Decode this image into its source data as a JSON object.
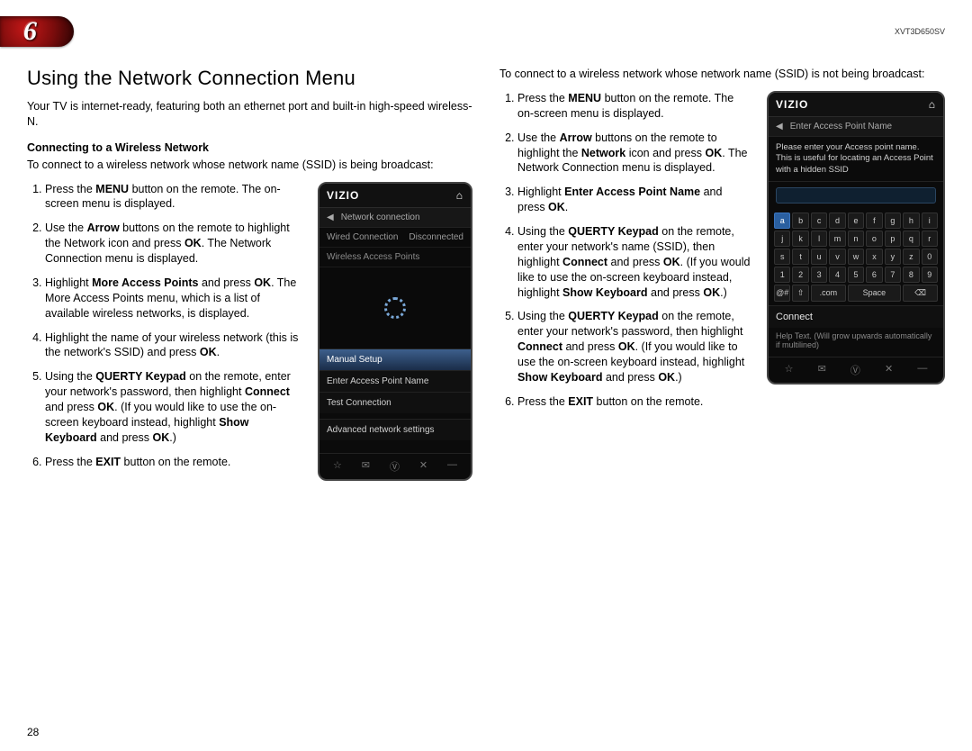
{
  "chapter_number": "6",
  "model": "XVT3D650SV",
  "page_number": "28",
  "left": {
    "title": "Using the Network Connection Menu",
    "intro": "Your TV is internet-ready, featuring both an ethernet port and built-in high-speed wireless-N.",
    "subhead": "Connecting to a Wireless Network",
    "lead": "To connect to a wireless network whose network name (SSID) is being broadcast:",
    "steps": [
      "Press the <b>MENU</b> button on the remote. The on-screen menu is displayed.",
      "Use the <b>Arrow</b> buttons on the remote to highlight the Network icon and press <b>OK</b>. The Network Connection menu is displayed.",
      "Highlight <b>More Access Points</b> and press <b>OK</b>. The More Access Points menu, which is a list of available wireless networks, is displayed.",
      "Highlight the name of your wireless network (this is the network's SSID) and press <b>OK</b>.",
      "Using the <b>QUERTY Keypad</b> on the remote, enter your network's password, then highlight <b>Connect</b> and press <b>OK</b>. (If you would like to use the on-screen keyboard instead, highlight <b>Show Keyboard</b> and press <b>OK</b>.)",
      "Press the <b>EXIT</b> button on the remote."
    ],
    "menu": {
      "brand": "VIZIO",
      "crumb": "Network connection",
      "wired_label": "Wired Connection",
      "wired_status": "Disconnected",
      "wap_label": "Wireless Access Points",
      "items": [
        "Manual Setup",
        "Enter Access Point Name",
        "Test Connection",
        "Advanced network settings"
      ]
    }
  },
  "right": {
    "lead": "To connect to a wireless network whose network name (SSID) is not being broadcast:",
    "steps": [
      "Press the <b>MENU</b> button on the remote. The on-screen menu is displayed.",
      "Use the <b>Arrow</b> buttons on the remote to highlight the <b>Network</b> icon and press <b>OK</b>. The Network Connection menu is displayed.",
      "Highlight <b>Enter Access Point Name</b> and press <b>OK</b>.",
      "Using the <b>QUERTY Keypad</b> on the remote, enter your network's name (SSID), then highlight <b>Connect</b> and press <b>OK</b>. (If you would like to use the on-screen keyboard instead, highlight <b>Show Keyboard</b> and press <b>OK</b>.)",
      "Using the <b>QUERTY Keypad</b> on the remote, enter your network's password, then highlight <b>Connect</b> and press <b>OK</b>. (If you would like to use the on-screen keyboard instead, highlight <b>Show Keyboard</b> and press <b>OK</b>.)",
      "Press the <b>EXIT</b> button on the remote."
    ],
    "keyboard": {
      "brand": "VIZIO",
      "crumb": "Enter Access Point Name",
      "note": "Please enter your Access point name. This is useful for locating an Access Point with a hidden SSID",
      "rows": [
        [
          "a",
          "b",
          "c",
          "d",
          "e",
          "f",
          "g",
          "h",
          "i"
        ],
        [
          "j",
          "k",
          "l",
          "m",
          "n",
          "o",
          "p",
          "q",
          "r"
        ],
        [
          "s",
          "t",
          "u",
          "v",
          "w",
          "x",
          "y",
          "z",
          "0"
        ],
        [
          "1",
          "2",
          "3",
          "4",
          "5",
          "6",
          "7",
          "8",
          "9"
        ]
      ],
      "special": [
        "@#",
        "⇧",
        ".com",
        "Space",
        "⌫"
      ],
      "connect": "Connect",
      "help": "Help Text. (Will grow upwards automatically if multilined)"
    }
  }
}
